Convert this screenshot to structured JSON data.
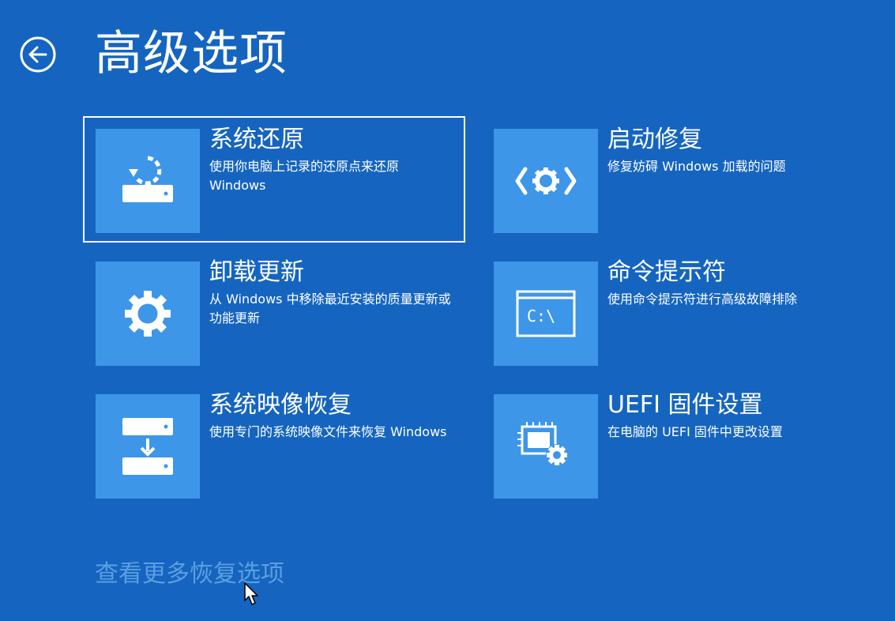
{
  "header": {
    "back_icon": "back-arrow-icon",
    "title": "高级选项"
  },
  "options": [
    {
      "id": "system-restore",
      "title": "系统还原",
      "description": "使用你电脑上记录的还原点来还原 Windows",
      "icon": "system-restore-icon",
      "selected": true
    },
    {
      "id": "startup-repair",
      "title": "启动修复",
      "description": "修复妨碍 Windows 加载的问题",
      "icon": "startup-repair-icon",
      "selected": false
    },
    {
      "id": "uninstall-updates",
      "title": "卸载更新",
      "description": "从 Windows 中移除最近安装的质量更新或功能更新",
      "icon": "gear-icon",
      "selected": false
    },
    {
      "id": "command-prompt",
      "title": "命令提示符",
      "description": "使用命令提示符进行高级故障排除",
      "icon": "command-prompt-icon",
      "icon_text": "C:\\",
      "selected": false
    },
    {
      "id": "system-image-recovery",
      "title": "系统映像恢复",
      "description": "使用专门的系统映像文件来恢复 Windows",
      "icon": "system-image-recovery-icon",
      "selected": false
    },
    {
      "id": "uefi-settings",
      "title": "UEFI 固件设置",
      "description": "在电脑的 UEFI 固件中更改设置",
      "icon": "uefi-firmware-icon",
      "selected": false
    }
  ],
  "footer": {
    "more_options_label": "查看更多恢复选项"
  },
  "colors": {
    "background": "#1565c0",
    "tile": "#3d96e8",
    "link": "#5a9fe0",
    "text": "#ffffff"
  }
}
